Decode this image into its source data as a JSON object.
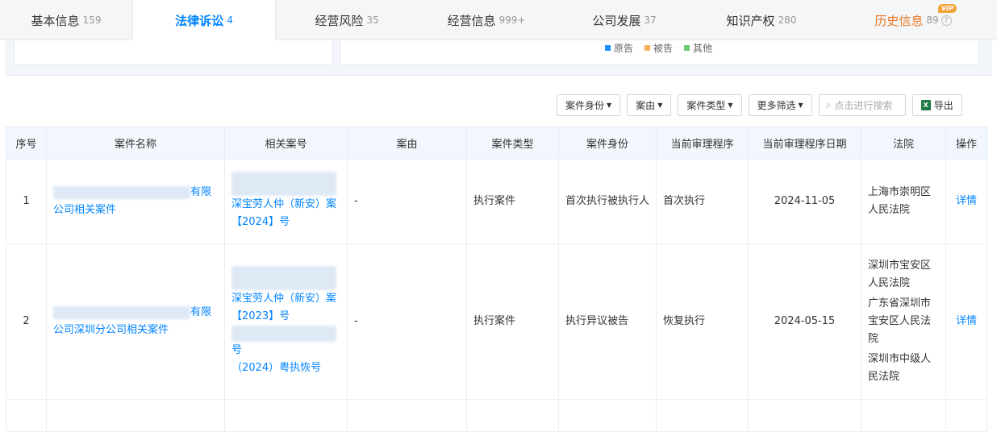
{
  "tabs": [
    {
      "label": "基本信息",
      "count": "159"
    },
    {
      "label": "法律诉讼",
      "count": "4"
    },
    {
      "label": "经营风险",
      "count": "35"
    },
    {
      "label": "经营信息",
      "count": "999+"
    },
    {
      "label": "公司发展",
      "count": "37"
    },
    {
      "label": "知识产权",
      "count": "280"
    },
    {
      "label": "历史信息",
      "count": "89",
      "badge": "VIP",
      "help": "?"
    }
  ],
  "legend": [
    {
      "label": "原告",
      "color": "#1e90ff"
    },
    {
      "label": "被告",
      "color": "#f5b45a"
    },
    {
      "label": "其他",
      "color": "#6cc97a"
    }
  ],
  "toolbar": {
    "filter_role": "案件身份",
    "filter_cause": "案由",
    "filter_type": "案件类型",
    "filter_more": "更多筛选",
    "search_placeholder": "点击进行搜索",
    "export": "导出"
  },
  "table": {
    "headers": [
      "序号",
      "案件名称",
      "相关案号",
      "案由",
      "案件类型",
      "案件身份",
      "当前审理程序",
      "当前审理程序日期",
      "法院",
      "操作"
    ],
    "rows": [
      {
        "no": "1",
        "name": "有限公司相关案件",
        "case_nos": [
          "深宝劳人仲（新安）案【2024】号"
        ],
        "cause": "-",
        "type": "执行案件",
        "role": "首次执行被执行人",
        "stage": "首次执行",
        "date": "2024-11-05",
        "courts": [
          "上海市崇明区人民法院"
        ],
        "action": "详情"
      },
      {
        "no": "2",
        "name": "有限公司深圳分公司相关案件",
        "case_nos": [
          "深宝劳人仲（新安）案【2023】号",
          "号",
          "（2024）粤执恢号"
        ],
        "cause": "-",
        "type": "执行案件",
        "role": "执行异议被告",
        "stage": "恢复执行",
        "date": "2024-05-15",
        "courts": [
          "深圳市宝安区人民法院",
          "广东省深圳市宝安区人民法院",
          "深圳市中级人民法院"
        ],
        "action": "详情"
      }
    ]
  }
}
